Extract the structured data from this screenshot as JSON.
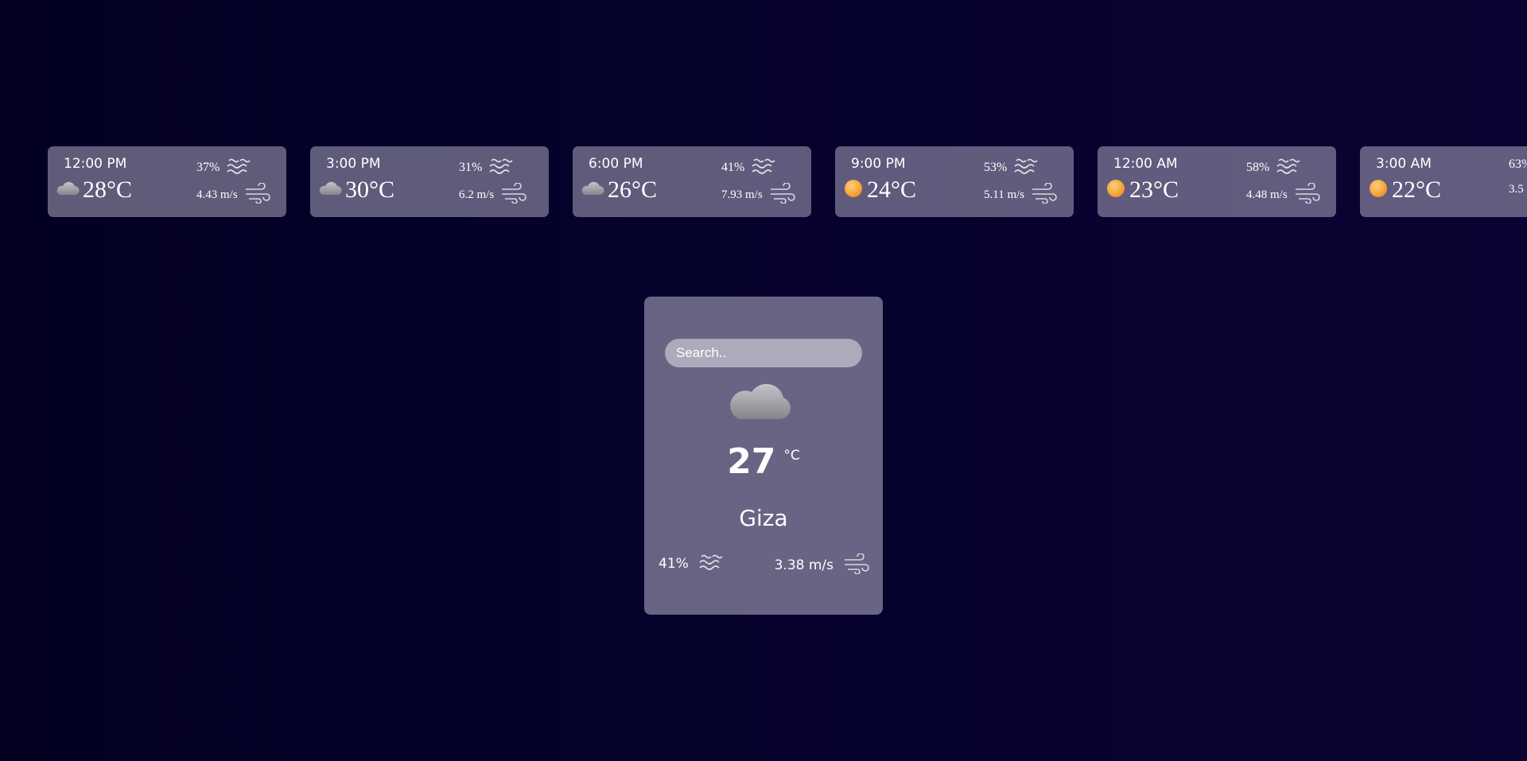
{
  "forecast": [
    {
      "time": "12:00 PM",
      "temp": "28°C",
      "humidity": "37%",
      "wind": "4.43 m/s",
      "icon": "cloud-icon"
    },
    {
      "time": "3:00 PM",
      "temp": "30°C",
      "humidity": "31%",
      "wind": "6.2 m/s",
      "icon": "cloud-icon"
    },
    {
      "time": "6:00 PM",
      "temp": "26°C",
      "humidity": "41%",
      "wind": "7.93 m/s",
      "icon": "cloud-icon"
    },
    {
      "time": "9:00 PM",
      "temp": "24°C",
      "humidity": "53%",
      "wind": "5.11 m/s",
      "icon": "sun-icon"
    },
    {
      "time": "12:00 AM",
      "temp": "23°C",
      "humidity": "58%",
      "wind": "4.48 m/s",
      "icon": "sun-icon"
    },
    {
      "time": "3:00 AM",
      "temp": "22°C",
      "humidity": "63%",
      "wind": "3.5",
      "icon": "sun-icon"
    }
  ],
  "main": {
    "search_placeholder": "Search..",
    "icon": "cloud-icon",
    "temp": "27",
    "unit": "°C",
    "city": "Giza",
    "humidity": "41%",
    "wind": "3.38 m/s"
  },
  "colors": {
    "card_bg": "#6a6580",
    "sun": "#f5a53a",
    "cloud": "#a8a8ae"
  }
}
